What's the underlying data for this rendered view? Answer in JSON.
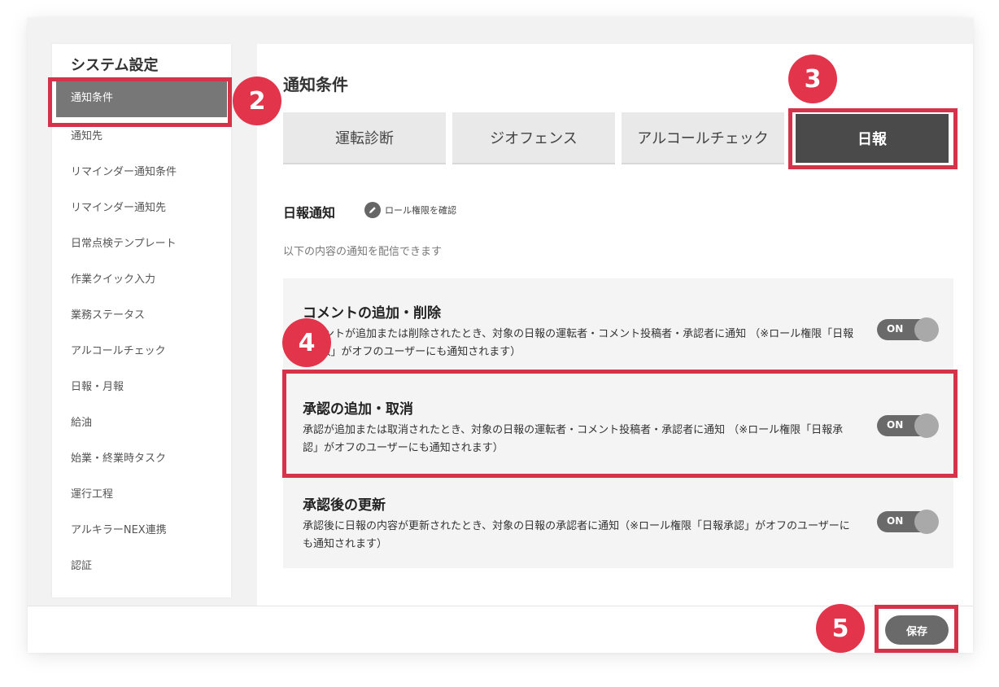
{
  "sidebar": {
    "title": "システム設定",
    "items": [
      {
        "label": "通知条件",
        "active": true
      },
      {
        "label": "通知先"
      },
      {
        "label": "リマインダー通知条件"
      },
      {
        "label": "リマインダー通知先"
      },
      {
        "label": "日常点検テンプレート"
      },
      {
        "label": "作業クイック入力"
      },
      {
        "label": "業務ステータス"
      },
      {
        "label": "アルコールチェック"
      },
      {
        "label": "日報・月報"
      },
      {
        "label": "給油"
      },
      {
        "label": "始業・終業時タスク"
      },
      {
        "label": "運行工程"
      },
      {
        "label": "アルキラーNEX連携"
      },
      {
        "label": "認証"
      }
    ]
  },
  "main": {
    "title": "通知条件",
    "tabs": [
      {
        "label": "運転診断"
      },
      {
        "label": "ジオフェンス"
      },
      {
        "label": "アルコールチェック"
      },
      {
        "label": "日報",
        "active": true
      }
    ],
    "section_title": "日報通知",
    "role_link": "ロール権限を確認",
    "section_desc": "以下の内容の通知を配信できます",
    "settings": [
      {
        "title": "コメントの追加・削除",
        "desc": "コメントが追加または削除されたとき、対象の日報の運転者・コメント投稿者・承認者に通知 （※ロール権限「日報 / 月報」がオフのユーザーにも通知されます）",
        "toggle": "ON"
      },
      {
        "title": "承認の追加・取消",
        "desc": "承認が追加または取消されたとき、対象の日報の運転者・コメント投稿者・承認者に通知 （※ロール権限「日報承認」がオフのユーザーにも通知されます）",
        "toggle": "ON"
      },
      {
        "title": "承認後の更新",
        "desc": "承認後に日報の内容が更新されたとき、対象の日報の承認者に通知（※ロール権限「日報承認」がオフのユーザーにも通知されます）",
        "toggle": "ON"
      }
    ]
  },
  "footer": {
    "save_label": "保存"
  },
  "annotations": {
    "badges": [
      "2",
      "3",
      "4",
      "5"
    ],
    "color": "#e2354b"
  },
  "colors": {
    "highlight": "#d4334a",
    "active_tab": "#4a4a4a",
    "active_nav": "#777777",
    "toggle": "#6a6a6a"
  }
}
